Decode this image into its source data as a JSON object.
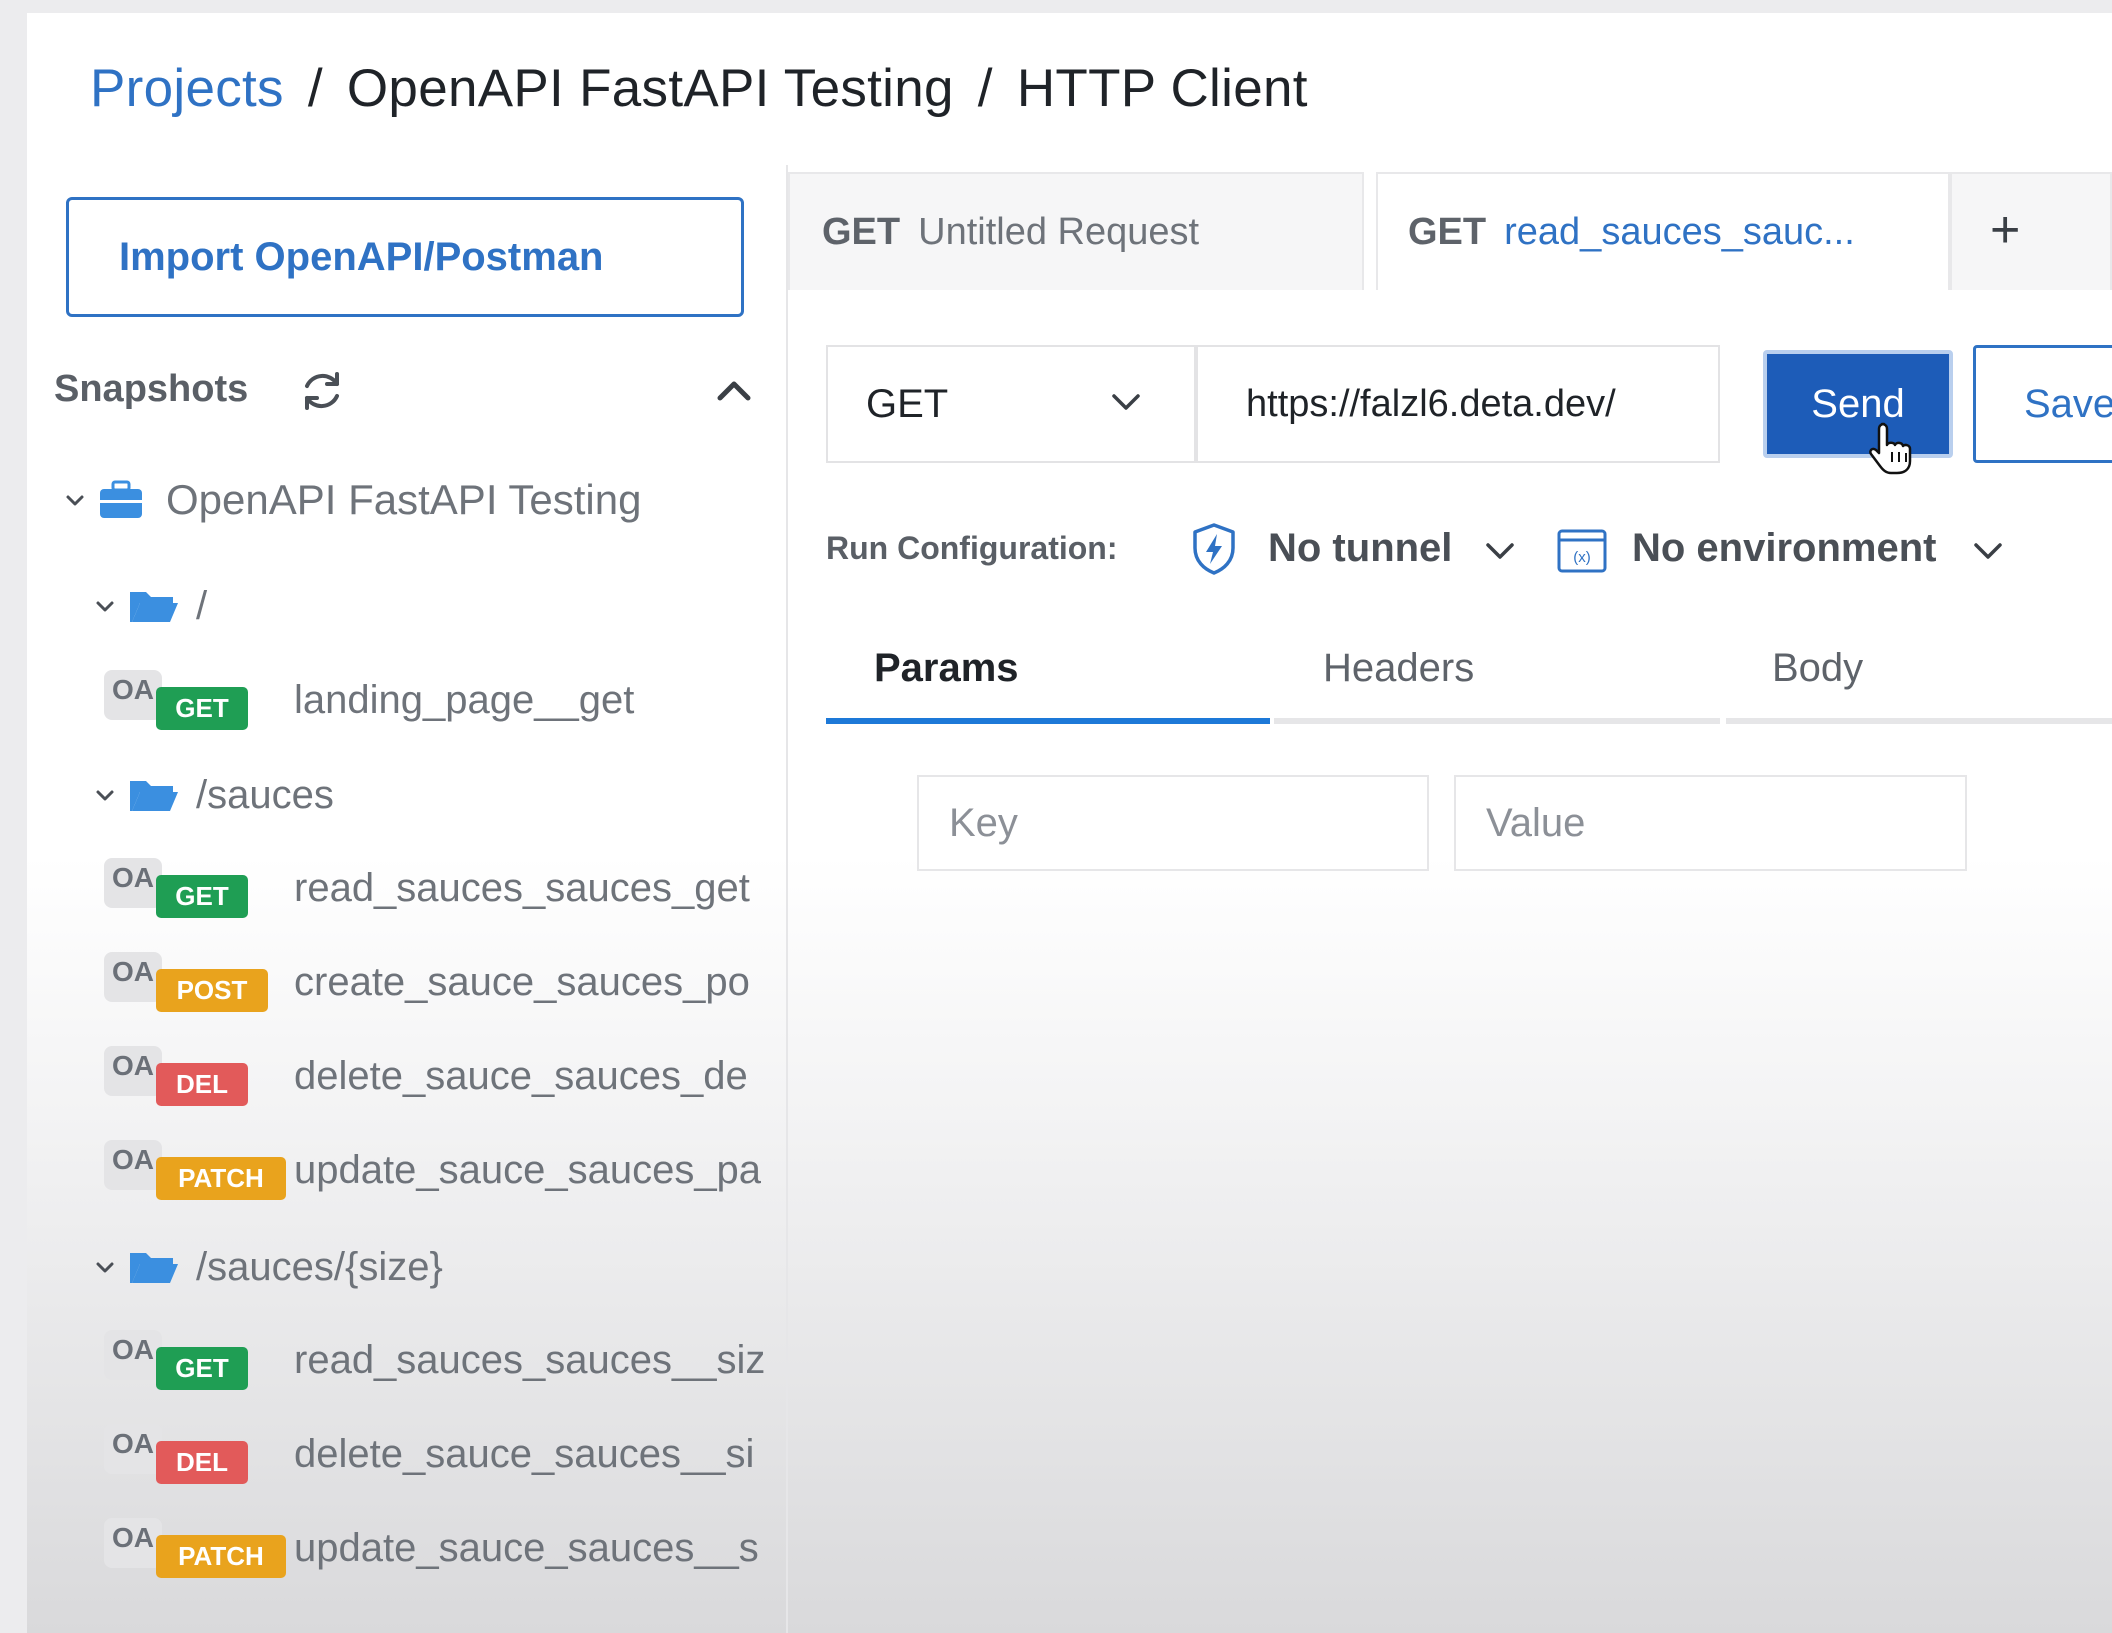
{
  "breadcrumb": {
    "projects": "Projects",
    "sep1": "/",
    "project": "OpenAPI FastAPI Testing",
    "sep2": "/",
    "page": "HTTP Client"
  },
  "sidebar": {
    "import_label": "Import OpenAPI/Postman",
    "snapshots_label": "Snapshots",
    "project_name": "OpenAPI FastAPI Testing",
    "groups": [
      {
        "path": "/",
        "endpoints": [
          {
            "badge": "OA",
            "method": "GET",
            "name": "landing_page__get"
          }
        ]
      },
      {
        "path": "/sauces",
        "endpoints": [
          {
            "badge": "OA",
            "method": "GET",
            "name": "read_sauces_sauces_get"
          },
          {
            "badge": "OA",
            "method": "POST",
            "name": "create_sauce_sauces_po"
          },
          {
            "badge": "OA",
            "method": "DEL",
            "name": "delete_sauce_sauces_de"
          },
          {
            "badge": "OA",
            "method": "PATCH",
            "name": "update_sauce_sauces_pa"
          }
        ]
      },
      {
        "path": "/sauces/{size}",
        "endpoints": [
          {
            "badge": "OA",
            "method": "GET",
            "name": "read_sauces_sauces__siz"
          },
          {
            "badge": "OA",
            "method": "DEL",
            "name": "delete_sauce_sauces__si"
          },
          {
            "badge": "OA",
            "method": "PATCH",
            "name": "update_sauce_sauces__s"
          }
        ]
      }
    ]
  },
  "tabs": [
    {
      "method": "GET",
      "name": "Untitled Request"
    },
    {
      "method": "GET",
      "name": "read_sauces_sauc..."
    }
  ],
  "add_tab_label": "+",
  "request": {
    "method": "GET",
    "url": "https://falzl6.deta.dev/",
    "send_label": "Send",
    "save_label": "Save"
  },
  "run_config": {
    "label": "Run Configuration:",
    "tunnel": "No tunnel",
    "environment": "No environment"
  },
  "param_tabs": [
    "Params",
    "Headers",
    "Body"
  ],
  "params": {
    "key_placeholder": "Key",
    "value_placeholder": "Value"
  },
  "colors": {
    "accent": "#2f72c4",
    "send": "#1d5cb8",
    "get": "#1f9e54",
    "post": "#e9a31d",
    "del": "#e25a5a",
    "patch": "#e9a31d"
  }
}
